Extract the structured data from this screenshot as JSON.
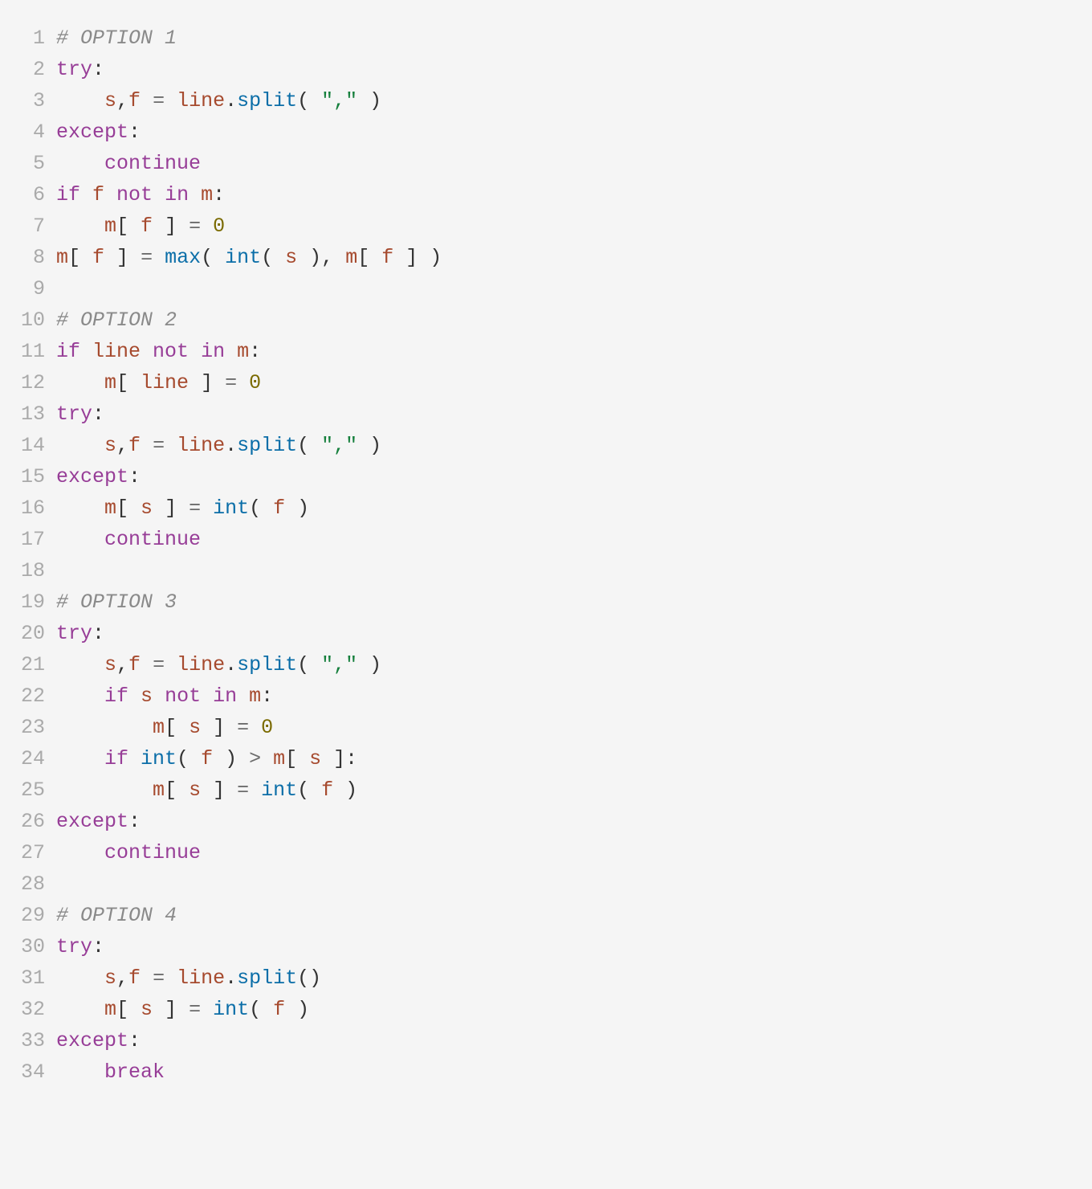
{
  "lines": [
    {
      "n": "1",
      "tokens": [
        {
          "t": "# OPTION 1",
          "c": "c-comment"
        }
      ]
    },
    {
      "n": "2",
      "tokens": [
        {
          "t": "try",
          "c": "c-keyword"
        },
        {
          "t": ":",
          "c": "c-punct"
        }
      ]
    },
    {
      "n": "3",
      "tokens": [
        {
          "t": "    "
        },
        {
          "t": "s",
          "c": "c-ident"
        },
        {
          "t": ",",
          "c": "c-punct"
        },
        {
          "t": "f",
          "c": "c-ident"
        },
        {
          "t": " = ",
          "c": "c-op"
        },
        {
          "t": "line",
          "c": "c-ident"
        },
        {
          "t": ".",
          "c": "c-punct"
        },
        {
          "t": "split",
          "c": "c-call"
        },
        {
          "t": "( ",
          "c": "c-punct"
        },
        {
          "t": "\",\"",
          "c": "c-string"
        },
        {
          "t": " )",
          "c": "c-punct"
        }
      ]
    },
    {
      "n": "4",
      "tokens": [
        {
          "t": "except",
          "c": "c-keyword"
        },
        {
          "t": ":",
          "c": "c-punct"
        }
      ]
    },
    {
      "n": "5",
      "tokens": [
        {
          "t": "    "
        },
        {
          "t": "continue",
          "c": "c-keyword"
        }
      ]
    },
    {
      "n": "6",
      "tokens": [
        {
          "t": "if ",
          "c": "c-keyword"
        },
        {
          "t": "f",
          "c": "c-ident"
        },
        {
          "t": " "
        },
        {
          "t": "not",
          "c": "c-keyword"
        },
        {
          "t": " "
        },
        {
          "t": "in",
          "c": "c-keyword"
        },
        {
          "t": " "
        },
        {
          "t": "m",
          "c": "c-ident"
        },
        {
          "t": ":",
          "c": "c-punct"
        }
      ]
    },
    {
      "n": "7",
      "tokens": [
        {
          "t": "    "
        },
        {
          "t": "m",
          "c": "c-ident"
        },
        {
          "t": "[ ",
          "c": "c-punct"
        },
        {
          "t": "f",
          "c": "c-ident"
        },
        {
          "t": " ]",
          "c": "c-punct"
        },
        {
          "t": " = ",
          "c": "c-op"
        },
        {
          "t": "0",
          "c": "c-number"
        }
      ]
    },
    {
      "n": "8",
      "tokens": [
        {
          "t": "m",
          "c": "c-ident"
        },
        {
          "t": "[ ",
          "c": "c-punct"
        },
        {
          "t": "f",
          "c": "c-ident"
        },
        {
          "t": " ]",
          "c": "c-punct"
        },
        {
          "t": " = ",
          "c": "c-op"
        },
        {
          "t": "max",
          "c": "c-call"
        },
        {
          "t": "( ",
          "c": "c-punct"
        },
        {
          "t": "int",
          "c": "c-call"
        },
        {
          "t": "( ",
          "c": "c-punct"
        },
        {
          "t": "s",
          "c": "c-ident"
        },
        {
          "t": " )",
          "c": "c-punct"
        },
        {
          "t": ", ",
          "c": "c-punct"
        },
        {
          "t": "m",
          "c": "c-ident"
        },
        {
          "t": "[ ",
          "c": "c-punct"
        },
        {
          "t": "f",
          "c": "c-ident"
        },
        {
          "t": " ]",
          "c": "c-punct"
        },
        {
          "t": " )",
          "c": "c-punct"
        }
      ]
    },
    {
      "n": "9",
      "tokens": []
    },
    {
      "n": "10",
      "tokens": [
        {
          "t": "# OPTION 2",
          "c": "c-comment"
        }
      ]
    },
    {
      "n": "11",
      "tokens": [
        {
          "t": "if ",
          "c": "c-keyword"
        },
        {
          "t": "line",
          "c": "c-ident"
        },
        {
          "t": " "
        },
        {
          "t": "not",
          "c": "c-keyword"
        },
        {
          "t": " "
        },
        {
          "t": "in",
          "c": "c-keyword"
        },
        {
          "t": " "
        },
        {
          "t": "m",
          "c": "c-ident"
        },
        {
          "t": ":",
          "c": "c-punct"
        }
      ]
    },
    {
      "n": "12",
      "tokens": [
        {
          "t": "    "
        },
        {
          "t": "m",
          "c": "c-ident"
        },
        {
          "t": "[ ",
          "c": "c-punct"
        },
        {
          "t": "line",
          "c": "c-ident"
        },
        {
          "t": " ]",
          "c": "c-punct"
        },
        {
          "t": " = ",
          "c": "c-op"
        },
        {
          "t": "0",
          "c": "c-number"
        }
      ]
    },
    {
      "n": "13",
      "tokens": [
        {
          "t": "try",
          "c": "c-keyword"
        },
        {
          "t": ":",
          "c": "c-punct"
        }
      ]
    },
    {
      "n": "14",
      "tokens": [
        {
          "t": "    "
        },
        {
          "t": "s",
          "c": "c-ident"
        },
        {
          "t": ",",
          "c": "c-punct"
        },
        {
          "t": "f",
          "c": "c-ident"
        },
        {
          "t": " = ",
          "c": "c-op"
        },
        {
          "t": "line",
          "c": "c-ident"
        },
        {
          "t": ".",
          "c": "c-punct"
        },
        {
          "t": "split",
          "c": "c-call"
        },
        {
          "t": "( ",
          "c": "c-punct"
        },
        {
          "t": "\",\"",
          "c": "c-string"
        },
        {
          "t": " )",
          "c": "c-punct"
        }
      ]
    },
    {
      "n": "15",
      "tokens": [
        {
          "t": "except",
          "c": "c-keyword"
        },
        {
          "t": ":",
          "c": "c-punct"
        }
      ]
    },
    {
      "n": "16",
      "tokens": [
        {
          "t": "    "
        },
        {
          "t": "m",
          "c": "c-ident"
        },
        {
          "t": "[ ",
          "c": "c-punct"
        },
        {
          "t": "s",
          "c": "c-ident"
        },
        {
          "t": " ]",
          "c": "c-punct"
        },
        {
          "t": " = ",
          "c": "c-op"
        },
        {
          "t": "int",
          "c": "c-call"
        },
        {
          "t": "( ",
          "c": "c-punct"
        },
        {
          "t": "f",
          "c": "c-ident"
        },
        {
          "t": " )",
          "c": "c-punct"
        }
      ]
    },
    {
      "n": "17",
      "tokens": [
        {
          "t": "    "
        },
        {
          "t": "continue",
          "c": "c-keyword"
        }
      ]
    },
    {
      "n": "18",
      "tokens": []
    },
    {
      "n": "19",
      "tokens": [
        {
          "t": "# OPTION 3",
          "c": "c-comment"
        }
      ]
    },
    {
      "n": "20",
      "tokens": [
        {
          "t": "try",
          "c": "c-keyword"
        },
        {
          "t": ":",
          "c": "c-punct"
        }
      ]
    },
    {
      "n": "21",
      "tokens": [
        {
          "t": "    "
        },
        {
          "t": "s",
          "c": "c-ident"
        },
        {
          "t": ",",
          "c": "c-punct"
        },
        {
          "t": "f",
          "c": "c-ident"
        },
        {
          "t": " = ",
          "c": "c-op"
        },
        {
          "t": "line",
          "c": "c-ident"
        },
        {
          "t": ".",
          "c": "c-punct"
        },
        {
          "t": "split",
          "c": "c-call"
        },
        {
          "t": "( ",
          "c": "c-punct"
        },
        {
          "t": "\",\"",
          "c": "c-string"
        },
        {
          "t": " )",
          "c": "c-punct"
        }
      ]
    },
    {
      "n": "22",
      "tokens": [
        {
          "t": "    "
        },
        {
          "t": "if ",
          "c": "c-keyword"
        },
        {
          "t": "s",
          "c": "c-ident"
        },
        {
          "t": " "
        },
        {
          "t": "not",
          "c": "c-keyword"
        },
        {
          "t": " "
        },
        {
          "t": "in",
          "c": "c-keyword"
        },
        {
          "t": " "
        },
        {
          "t": "m",
          "c": "c-ident"
        },
        {
          "t": ":",
          "c": "c-punct"
        }
      ]
    },
    {
      "n": "23",
      "tokens": [
        {
          "t": "        "
        },
        {
          "t": "m",
          "c": "c-ident"
        },
        {
          "t": "[ ",
          "c": "c-punct"
        },
        {
          "t": "s",
          "c": "c-ident"
        },
        {
          "t": " ]",
          "c": "c-punct"
        },
        {
          "t": " = ",
          "c": "c-op"
        },
        {
          "t": "0",
          "c": "c-number"
        }
      ]
    },
    {
      "n": "24",
      "tokens": [
        {
          "t": "    "
        },
        {
          "t": "if ",
          "c": "c-keyword"
        },
        {
          "t": "int",
          "c": "c-call"
        },
        {
          "t": "( ",
          "c": "c-punct"
        },
        {
          "t": "f",
          "c": "c-ident"
        },
        {
          "t": " )",
          "c": "c-punct"
        },
        {
          "t": " > ",
          "c": "c-op"
        },
        {
          "t": "m",
          "c": "c-ident"
        },
        {
          "t": "[ ",
          "c": "c-punct"
        },
        {
          "t": "s",
          "c": "c-ident"
        },
        {
          "t": " ]",
          "c": "c-punct"
        },
        {
          "t": ":",
          "c": "c-punct"
        }
      ]
    },
    {
      "n": "25",
      "tokens": [
        {
          "t": "        "
        },
        {
          "t": "m",
          "c": "c-ident"
        },
        {
          "t": "[ ",
          "c": "c-punct"
        },
        {
          "t": "s",
          "c": "c-ident"
        },
        {
          "t": " ]",
          "c": "c-punct"
        },
        {
          "t": " = ",
          "c": "c-op"
        },
        {
          "t": "int",
          "c": "c-call"
        },
        {
          "t": "( ",
          "c": "c-punct"
        },
        {
          "t": "f",
          "c": "c-ident"
        },
        {
          "t": " )",
          "c": "c-punct"
        }
      ]
    },
    {
      "n": "26",
      "tokens": [
        {
          "t": "except",
          "c": "c-keyword"
        },
        {
          "t": ":",
          "c": "c-punct"
        }
      ]
    },
    {
      "n": "27",
      "tokens": [
        {
          "t": "    "
        },
        {
          "t": "continue",
          "c": "c-keyword"
        }
      ]
    },
    {
      "n": "28",
      "tokens": []
    },
    {
      "n": "29",
      "tokens": [
        {
          "t": "# OPTION 4",
          "c": "c-comment"
        }
      ]
    },
    {
      "n": "30",
      "tokens": [
        {
          "t": "try",
          "c": "c-keyword"
        },
        {
          "t": ":",
          "c": "c-punct"
        }
      ]
    },
    {
      "n": "31",
      "tokens": [
        {
          "t": "    "
        },
        {
          "t": "s",
          "c": "c-ident"
        },
        {
          "t": ",",
          "c": "c-punct"
        },
        {
          "t": "f",
          "c": "c-ident"
        },
        {
          "t": " = ",
          "c": "c-op"
        },
        {
          "t": "line",
          "c": "c-ident"
        },
        {
          "t": ".",
          "c": "c-punct"
        },
        {
          "t": "split",
          "c": "c-call"
        },
        {
          "t": "()",
          "c": "c-punct"
        }
      ]
    },
    {
      "n": "32",
      "tokens": [
        {
          "t": "    "
        },
        {
          "t": "m",
          "c": "c-ident"
        },
        {
          "t": "[ ",
          "c": "c-punct"
        },
        {
          "t": "s",
          "c": "c-ident"
        },
        {
          "t": " ]",
          "c": "c-punct"
        },
        {
          "t": " = ",
          "c": "c-op"
        },
        {
          "t": "int",
          "c": "c-call"
        },
        {
          "t": "( ",
          "c": "c-punct"
        },
        {
          "t": "f",
          "c": "c-ident"
        },
        {
          "t": " )",
          "c": "c-punct"
        }
      ]
    },
    {
      "n": "33",
      "tokens": [
        {
          "t": "except",
          "c": "c-keyword"
        },
        {
          "t": ":",
          "c": "c-punct"
        }
      ]
    },
    {
      "n": "34",
      "tokens": [
        {
          "t": "    "
        },
        {
          "t": "break",
          "c": "c-keyword"
        }
      ]
    }
  ]
}
